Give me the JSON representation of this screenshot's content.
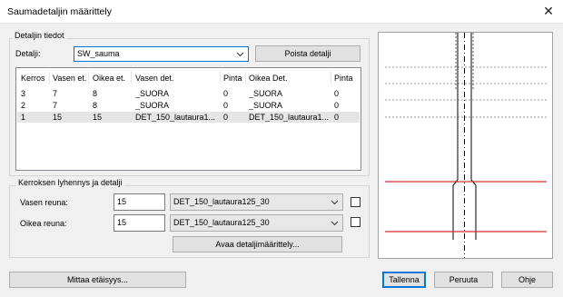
{
  "window": {
    "title": "Saumadetaljin määrittely",
    "close_glyph": "✕"
  },
  "details_group": {
    "label": "Detaljin tiedot",
    "detail_label": "Detalji:",
    "detail_value": "SW_sauma",
    "delete_button": "Poista detalji"
  },
  "table": {
    "columns": [
      "Kerros",
      "Vasen et.",
      "Oikea et.",
      "Vasen det.",
      "Pinta",
      "Oikea Det.",
      "Pinta"
    ],
    "rows": [
      [
        "3",
        "7",
        "8",
        "_SUORA",
        "0",
        "_SUORA",
        "0"
      ],
      [
        "2",
        "7",
        "8",
        "_SUORA",
        "0",
        "_SUORA",
        "0"
      ],
      [
        "1",
        "15",
        "15",
        "DET_150_lautaura1...",
        "0",
        "DET_150_lautaura1...",
        "0"
      ]
    ],
    "selected_row": 2
  },
  "shortening_group": {
    "label": "Kerroksen lyhennys ja detalji",
    "left_label": "Vasen reuna:",
    "left_value": "15",
    "left_detail": "DET_150_lautaura125_30",
    "right_label": "Oikea reuna:",
    "right_value": "15",
    "right_detail": "DET_150_lautaura125_30",
    "open_detail_button": "Avaa detaljimäärittely..."
  },
  "footer": {
    "measure_button": "Mittaa etäisyys...",
    "save_button": "Tallenna",
    "cancel_button": "Peruuta",
    "help_button": "Ohje"
  },
  "colors": {
    "accent": "#0078d7",
    "preview_red": "#d9302c"
  }
}
